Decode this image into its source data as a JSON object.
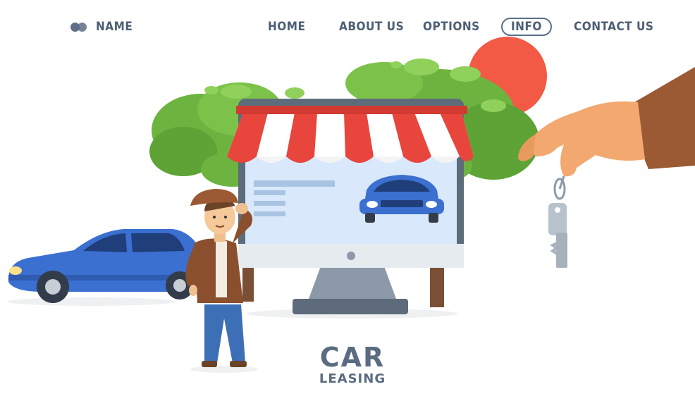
{
  "nav": {
    "brand": "NAME",
    "items": [
      "HOME",
      "ABOUT US",
      "OPTIONS",
      "INFO",
      "CONTACT US"
    ],
    "active": "INFO"
  },
  "hero": {
    "title": "CAR",
    "subtitle": "LEASING"
  },
  "icons": {
    "logo": "two-circles-logo-icon",
    "keys": "car-keys-icon"
  },
  "colors": {
    "nav_text": "#4b5e74",
    "awning_red": "#e8453c",
    "car_blue": "#3b6fd0",
    "sun": "#f25a45",
    "tree_green": "#6cb33f",
    "screen_bg": "#d9e9fb"
  }
}
